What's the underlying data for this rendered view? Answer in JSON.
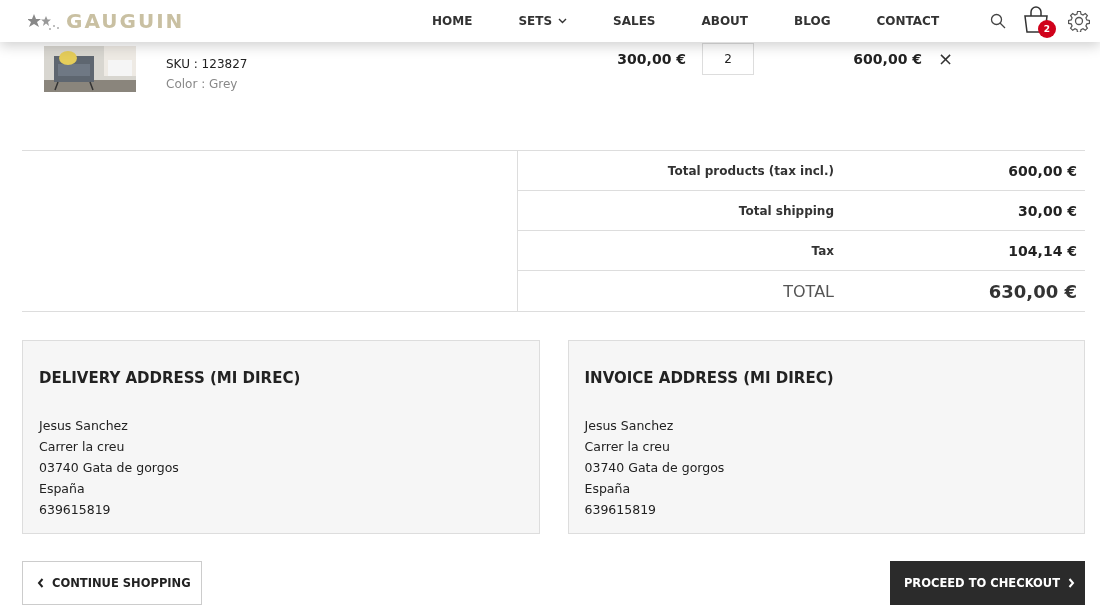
{
  "header": {
    "logo": "GAUGUIN",
    "nav": [
      {
        "label": "HOME",
        "dropdown": false
      },
      {
        "label": "SETS",
        "dropdown": true
      },
      {
        "label": "SALES",
        "dropdown": false
      },
      {
        "label": "ABOUT",
        "dropdown": false
      },
      {
        "label": "BLOG",
        "dropdown": false
      },
      {
        "label": "CONTACT",
        "dropdown": false
      }
    ],
    "cart_count": "2"
  },
  "cart_item": {
    "kind": "picture",
    "sku": "SKU : 123827",
    "variant": "Color : Grey",
    "price": "300,00 €",
    "quantity": "2",
    "total": "600,00 €",
    "remove": "×"
  },
  "totals": [
    {
      "label": "Total products (tax incl.)",
      "value": "600,00 €",
      "grand": false
    },
    {
      "label": "Total shipping",
      "value": "30,00 €",
      "grand": false
    },
    {
      "label": "Tax",
      "value": "104,14 €",
      "grand": false
    },
    {
      "label": "TOTAL",
      "value": "630,00 €",
      "grand": true
    }
  ],
  "addresses": [
    {
      "title": "DELIVERY ADDRESS (MI DIREC)",
      "lines": [
        "Jesus Sanchez",
        "Carrer la creu",
        "03740 Gata de gorgos",
        "España",
        "639615819"
      ]
    },
    {
      "title": "INVOICE ADDRESS (MI DIREC)",
      "lines": [
        "Jesus Sanchez",
        "Carrer la creu",
        "03740 Gata de gorgos",
        "España",
        "639615819"
      ]
    }
  ],
  "buttons": {
    "continue": "CONTINUE SHOPPING",
    "checkout": "PROCEED TO CHECKOUT"
  }
}
